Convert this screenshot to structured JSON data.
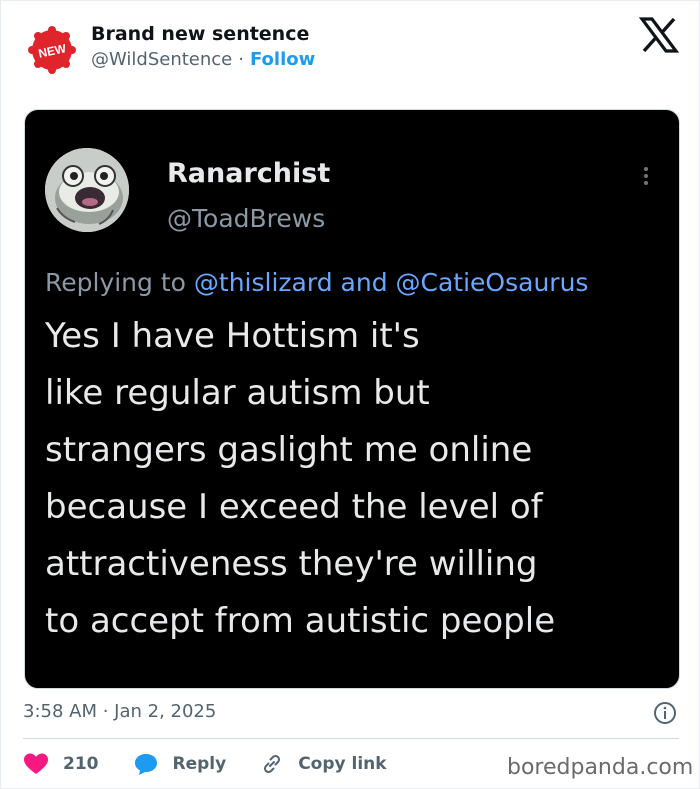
{
  "author": {
    "name": "Brand new sentence",
    "handle": "@WildSentence",
    "separator": "·",
    "follow_label": "Follow",
    "avatar_badge": "NEW"
  },
  "platform_icon": "x-logo-icon",
  "embedded_post": {
    "name": "Ranarchist",
    "handle": "@ToadBrews",
    "replying_prefix": "Replying to",
    "mention_1": "@thislizard",
    "and": "and",
    "mention_2": "@CatieOsaurus",
    "lines": [
      "Yes I have Hottism it's",
      "like regular autism but",
      "strangers gaslight me online",
      "because I exceed the level of",
      "attractiveness they're willing",
      "to accept from autistic people"
    ]
  },
  "timestamp": "3:58 AM · Jan 2, 2025",
  "actions": {
    "likes": "210",
    "reply_label": "Reply",
    "copy_label": "Copy link"
  },
  "watermark": "boredpanda.com",
  "colors": {
    "like": "#f91880",
    "reply": "#1d9bf0",
    "follow": "#1d9bf0",
    "badge": "#e0242b"
  }
}
